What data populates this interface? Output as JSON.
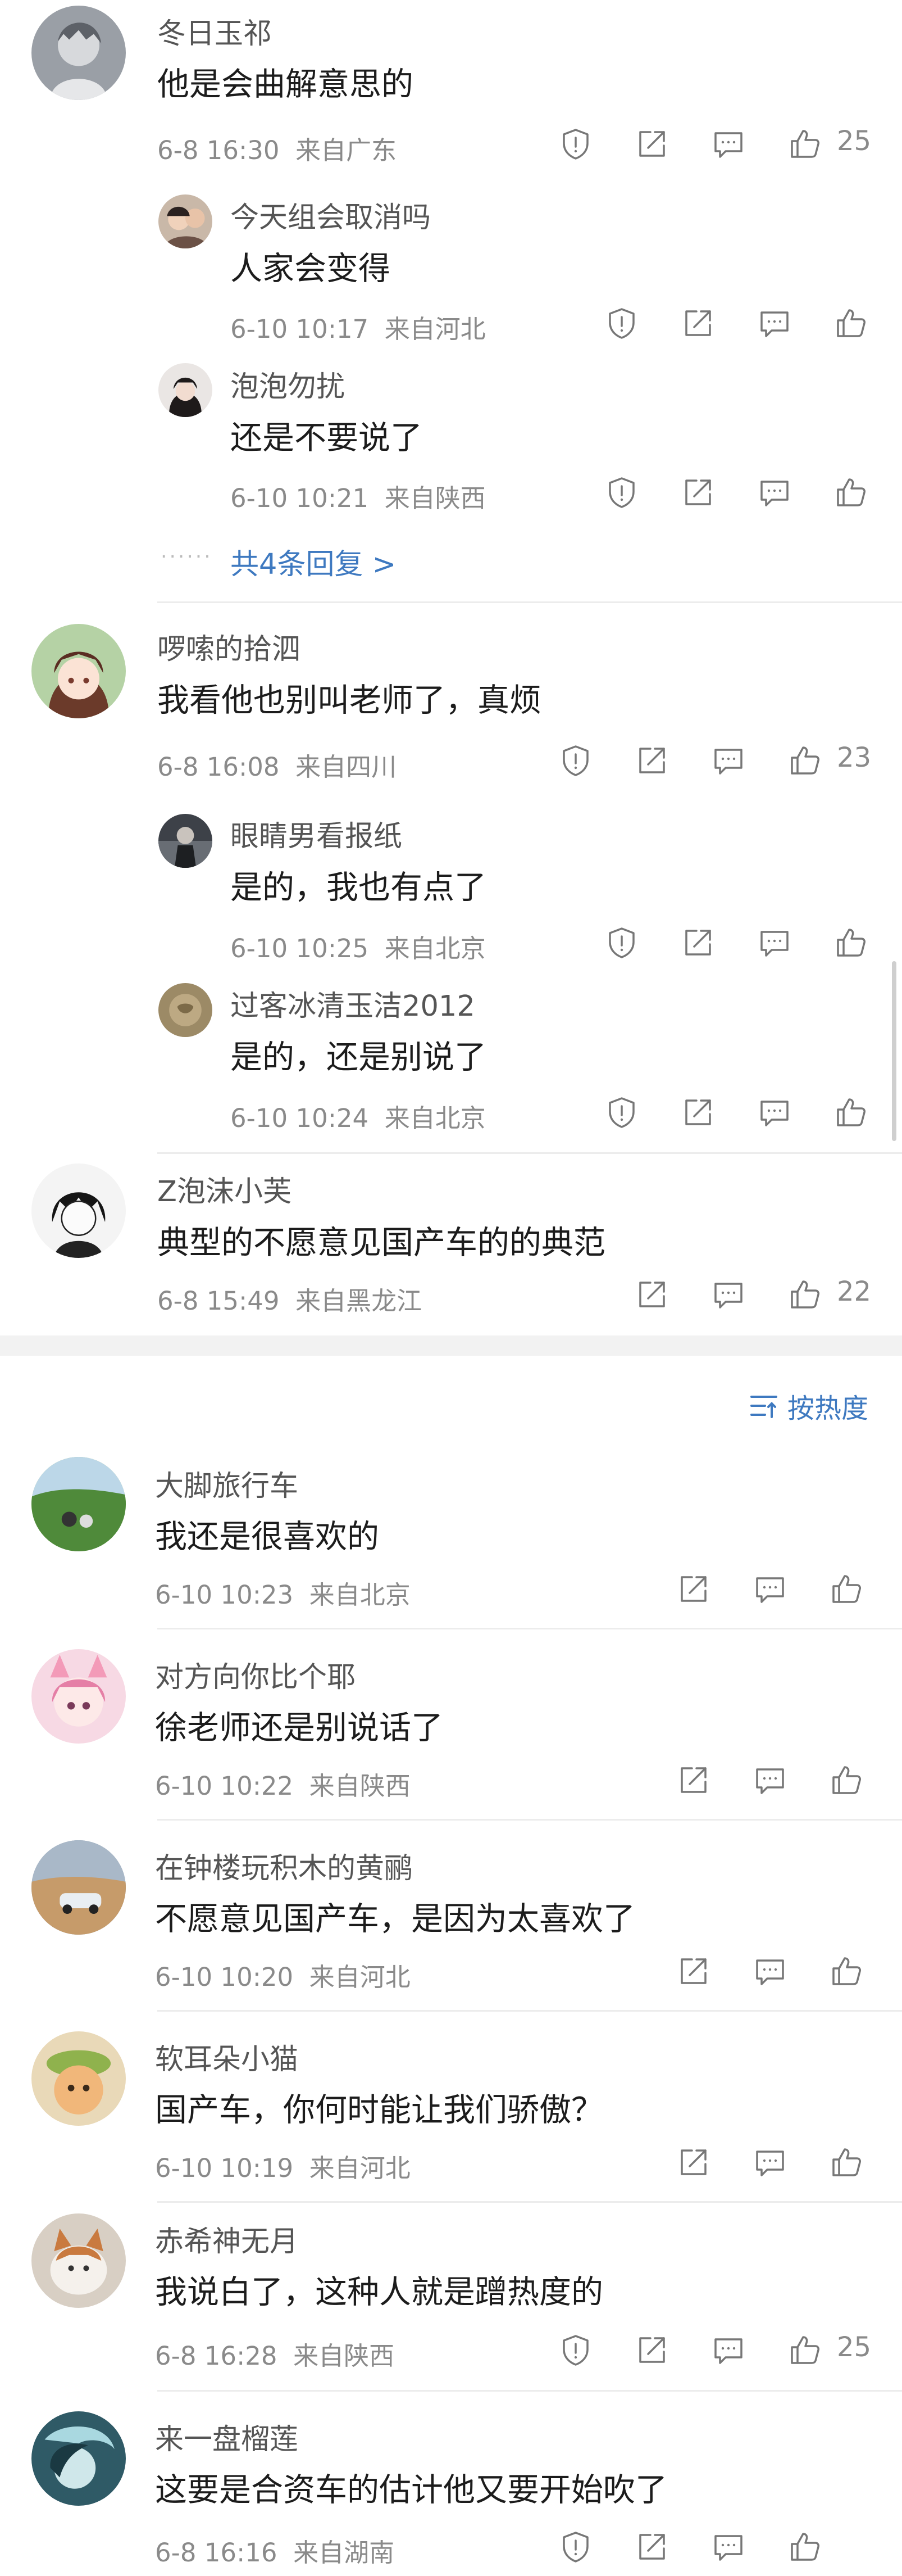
{
  "top_comments": [
    {
      "user": "冬日玉祁",
      "text": "他是会曲解意思的",
      "date": "6-8 16:30",
      "location": "来自广东",
      "likes": "25",
      "replies": [
        {
          "user": "今天组会取消吗",
          "text": "人家会变得",
          "date": "6-10 10:17",
          "location": "来自河北"
        },
        {
          "user": "泡泡勿扰",
          "text": "还是不要说了",
          "date": "6-10 10:21",
          "location": "来自陕西"
        }
      ],
      "more_replies": "共4条回复 >"
    },
    {
      "user": "啰嗦的拾泗",
      "text": "我看他也别叫老师了，真烦",
      "date": "6-8 16:08",
      "location": "来自四川",
      "likes": "23",
      "replies": [
        {
          "user": "眼睛男看报纸",
          "text": "是的，我也有点了",
          "date": "6-10 10:25",
          "location": "来自北京"
        },
        {
          "user": "过客冰清玉洁2012",
          "text": "是的，还是别说了",
          "date": "6-10 10:24",
          "location": "来自北京"
        }
      ]
    },
    {
      "user": "Z泡沫小芙",
      "text": "典型的不愿意见国产车的的典范",
      "date": "6-8 15:49",
      "location": "来自黑龙江",
      "likes": "22"
    }
  ],
  "sort_label": "按热度",
  "comments": [
    {
      "user": "大脚旅行车",
      "text": "我还是很喜欢的",
      "date": "6-10 10:23",
      "location": "来自北京"
    },
    {
      "user": "对方向你比个耶",
      "text": "徐老师还是别说话了",
      "date": "6-10 10:22",
      "location": "来自陕西"
    },
    {
      "user": "在钟楼玩积木的黄鹂",
      "text": "不愿意见国产车，是因为太喜欢了",
      "date": "6-10 10:20",
      "location": "来自河北"
    },
    {
      "user": "软耳朵小猫",
      "text": "国产车，你何时能让我们骄傲？",
      "date": "6-10 10:19",
      "location": "来自河北"
    },
    {
      "user": "赤希神无月",
      "text": "我说白了，这种人就是蹭热度的",
      "date": "6-8 16:28",
      "location": "来自陕西",
      "likes": "25"
    },
    {
      "user": "来一盘榴莲",
      "text": "这要是合资车的估计他又要开始吹了",
      "date": "6-8 16:16",
      "location": "来自湖南"
    }
  ],
  "colors": {
    "link": "#3e79c0",
    "meta": "#8a8a8a",
    "divider": "#ececec"
  },
  "icons": [
    "report-icon",
    "share-icon",
    "comment-icon",
    "like-icon",
    "sort-icon"
  ]
}
